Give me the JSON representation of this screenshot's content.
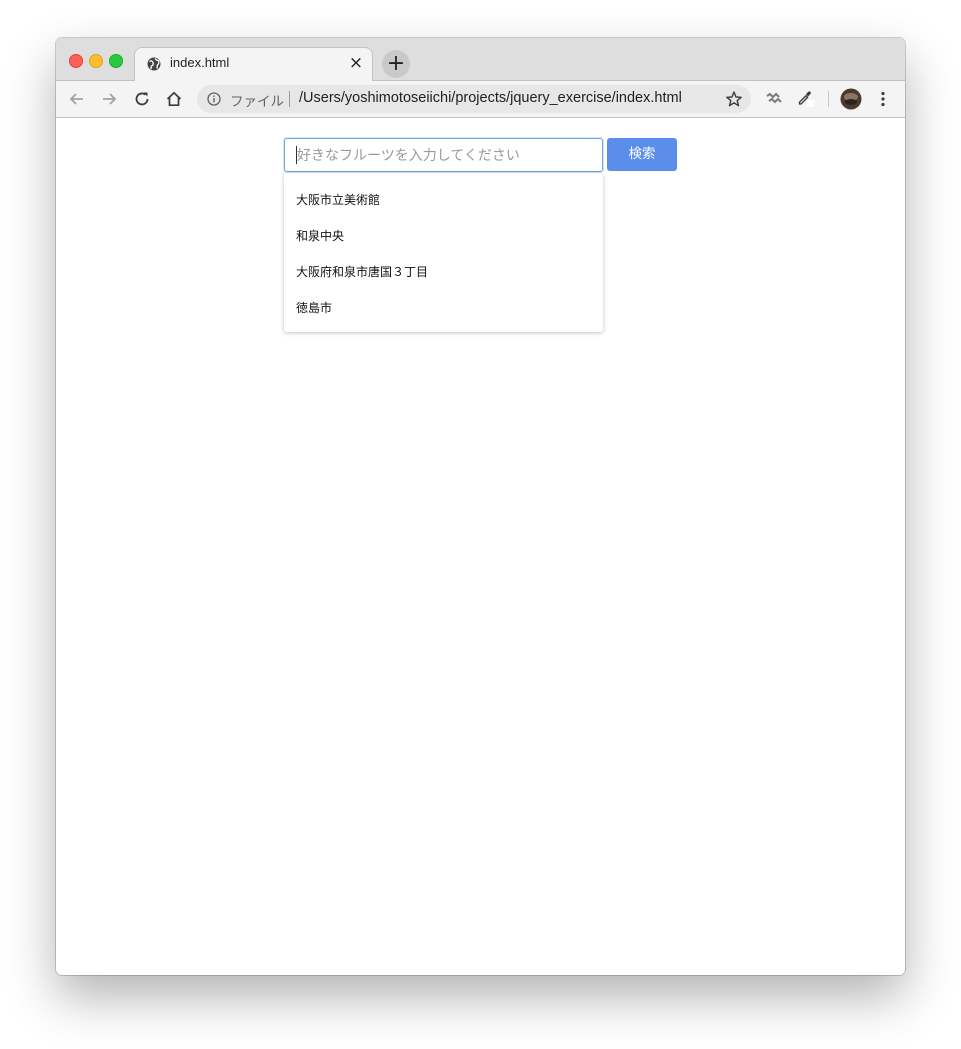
{
  "browser": {
    "tab": {
      "title": "index.html",
      "close_glyph": "×",
      "icon": "globe-icon"
    },
    "new_tab_glyph": "+",
    "address": {
      "scheme_label": "ファイル",
      "url": "/Users/yoshimotoseiichi/projects/jquery_exercise/index.html"
    }
  },
  "page": {
    "search": {
      "placeholder": "好きなフルーツを入力してください",
      "value": "",
      "button_label": "検索"
    },
    "suggestions": [
      "大阪市立美術館",
      "和泉中央",
      "大阪府和泉市唐国３丁目",
      "徳島市"
    ]
  },
  "colors": {
    "accent": "#5b8eea",
    "focus_border": "#6fa6e8"
  }
}
